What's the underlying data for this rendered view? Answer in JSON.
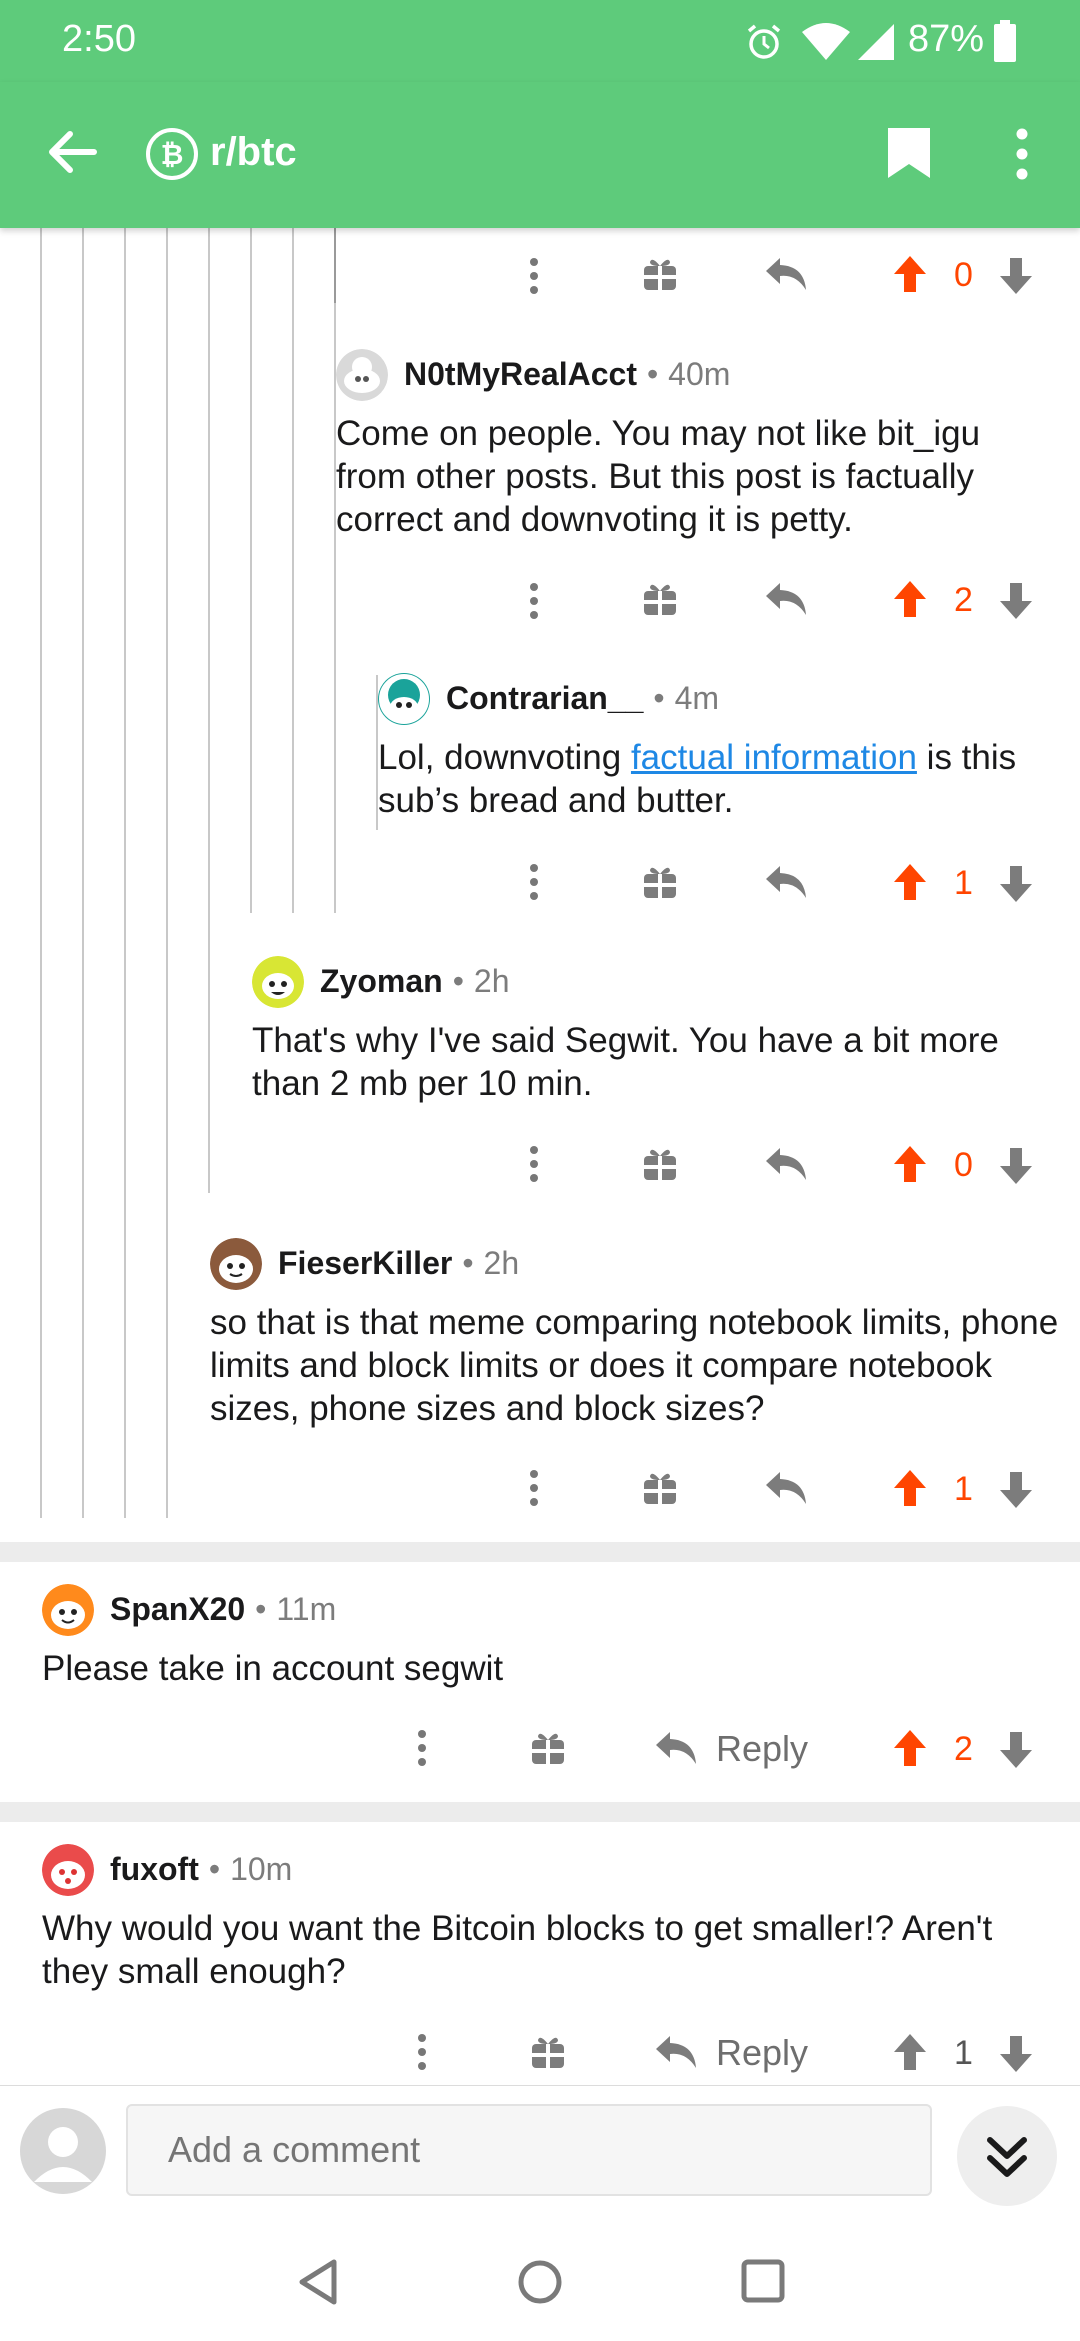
{
  "status_bar": {
    "time": "2:50",
    "battery": "87%"
  },
  "app_bar": {
    "subreddit": "r/btc",
    "back_icon": "arrow-left-icon",
    "bookmark_icon": "bookmark-icon",
    "menu_icon": "more-vertical-icon"
  },
  "colors": {
    "accent_green": "#5ecb7b",
    "upvote": "#ff4500",
    "link": "#1e88e5"
  },
  "comments": [
    {
      "user": "",
      "time": "",
      "body": "",
      "votes": "0"
    },
    {
      "user": "N0tMyRealAcct",
      "time": "40m",
      "body": "Come on people. You may not like bit_igu from other posts. But this post is factually correct and downvoting it is petty.",
      "votes": "2"
    },
    {
      "user": "Contrarian__",
      "time": "4m",
      "body_pre": "Lol, downvoting ",
      "body_link": "factual information",
      "body_post": " is this sub’s bread and butter.",
      "votes": "1"
    },
    {
      "user": "Zyoman",
      "time": "2h",
      "body": "That's why I've said Segwit. You have a bit more than 2 mb per 10 min.",
      "votes": "0"
    },
    {
      "user": "FieserKiller",
      "time": "2h",
      "body": "so that is that meme comparing notebook limits, phone limits and block limits or does it compare notebook sizes, phone sizes and block sizes?",
      "votes": "1"
    },
    {
      "user": "SpanX20",
      "time": "11m",
      "body": "Please take in account segwit",
      "votes": "2",
      "reply_label": "Reply"
    },
    {
      "user": "fuxoft",
      "time": "10m",
      "body": "Why would you want the Bitcoin blocks to get smaller!? Aren't they small enough?",
      "votes": "1",
      "reply_label": "Reply"
    }
  ],
  "separator": "•",
  "composer": {
    "placeholder": "Add a comment"
  }
}
